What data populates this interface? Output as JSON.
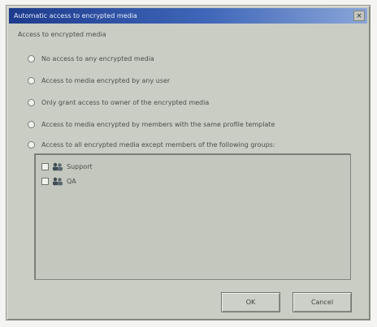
{
  "window": {
    "title": "Automatic access to encrypted media",
    "close_glyph": "×"
  },
  "group": {
    "label": "Access to encrypted media"
  },
  "options": [
    {
      "label": "No access to any encrypted media",
      "selected": false
    },
    {
      "label": "Access to media encrypted by any user",
      "selected": false
    },
    {
      "label": "Only grant access to owner of the encrypted media",
      "selected": false
    },
    {
      "label": "Access to media encrypted by members with the same profile template",
      "selected": false
    },
    {
      "label": "Access to all encrypted media except members of the following groups:",
      "selected": false
    }
  ],
  "groups_list": [
    {
      "name": "Support",
      "icon": "user-group-icon",
      "checked": false
    },
    {
      "name": "QA",
      "icon": "user-group-icon",
      "checked": false
    }
  ],
  "buttons": {
    "ok": "OK",
    "cancel": "Cancel"
  }
}
